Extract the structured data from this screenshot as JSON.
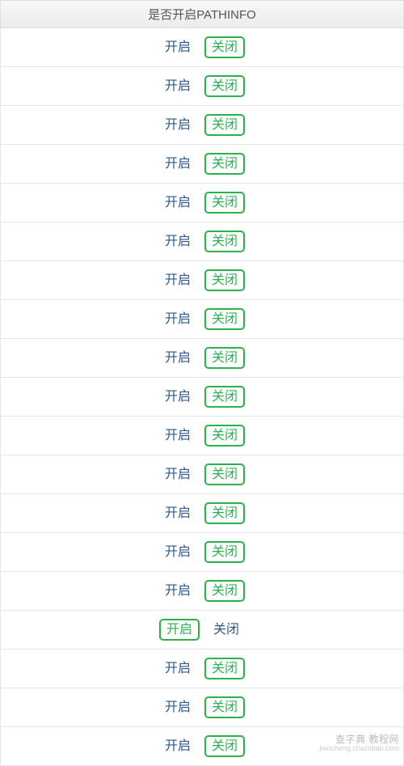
{
  "header": {
    "title": "是否开启PATHINFO"
  },
  "labels": {
    "on": "开启",
    "off": "关闭"
  },
  "rows": [
    {
      "selected": "off"
    },
    {
      "selected": "off"
    },
    {
      "selected": "off"
    },
    {
      "selected": "off"
    },
    {
      "selected": "off"
    },
    {
      "selected": "off"
    },
    {
      "selected": "off"
    },
    {
      "selected": "off"
    },
    {
      "selected": "off"
    },
    {
      "selected": "off"
    },
    {
      "selected": "off"
    },
    {
      "selected": "off"
    },
    {
      "selected": "off"
    },
    {
      "selected": "off"
    },
    {
      "selected": "off"
    },
    {
      "selected": "on"
    },
    {
      "selected": "off"
    },
    {
      "selected": "off"
    },
    {
      "selected": "off"
    }
  ],
  "watermark": {
    "line1": "查字典 教程网",
    "line2": "jiaocheng.chazidian.com"
  }
}
